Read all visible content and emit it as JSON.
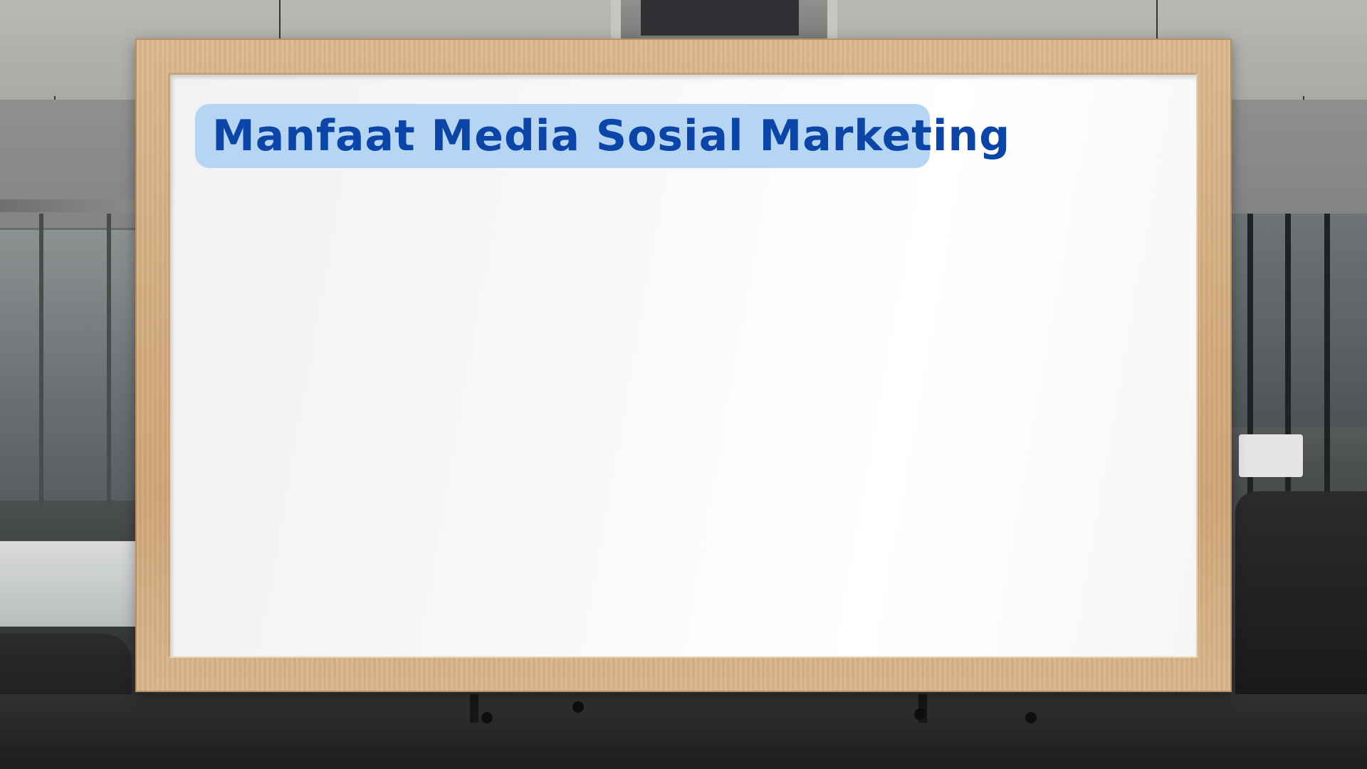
{
  "slide": {
    "title": "Manfaat Media Sosial Marketing"
  },
  "colors": {
    "title_text": "#0b45a8",
    "title_background": "#b5d5f2",
    "frame_wood": "#d4ad80",
    "board_white": "#f8f8f9"
  }
}
